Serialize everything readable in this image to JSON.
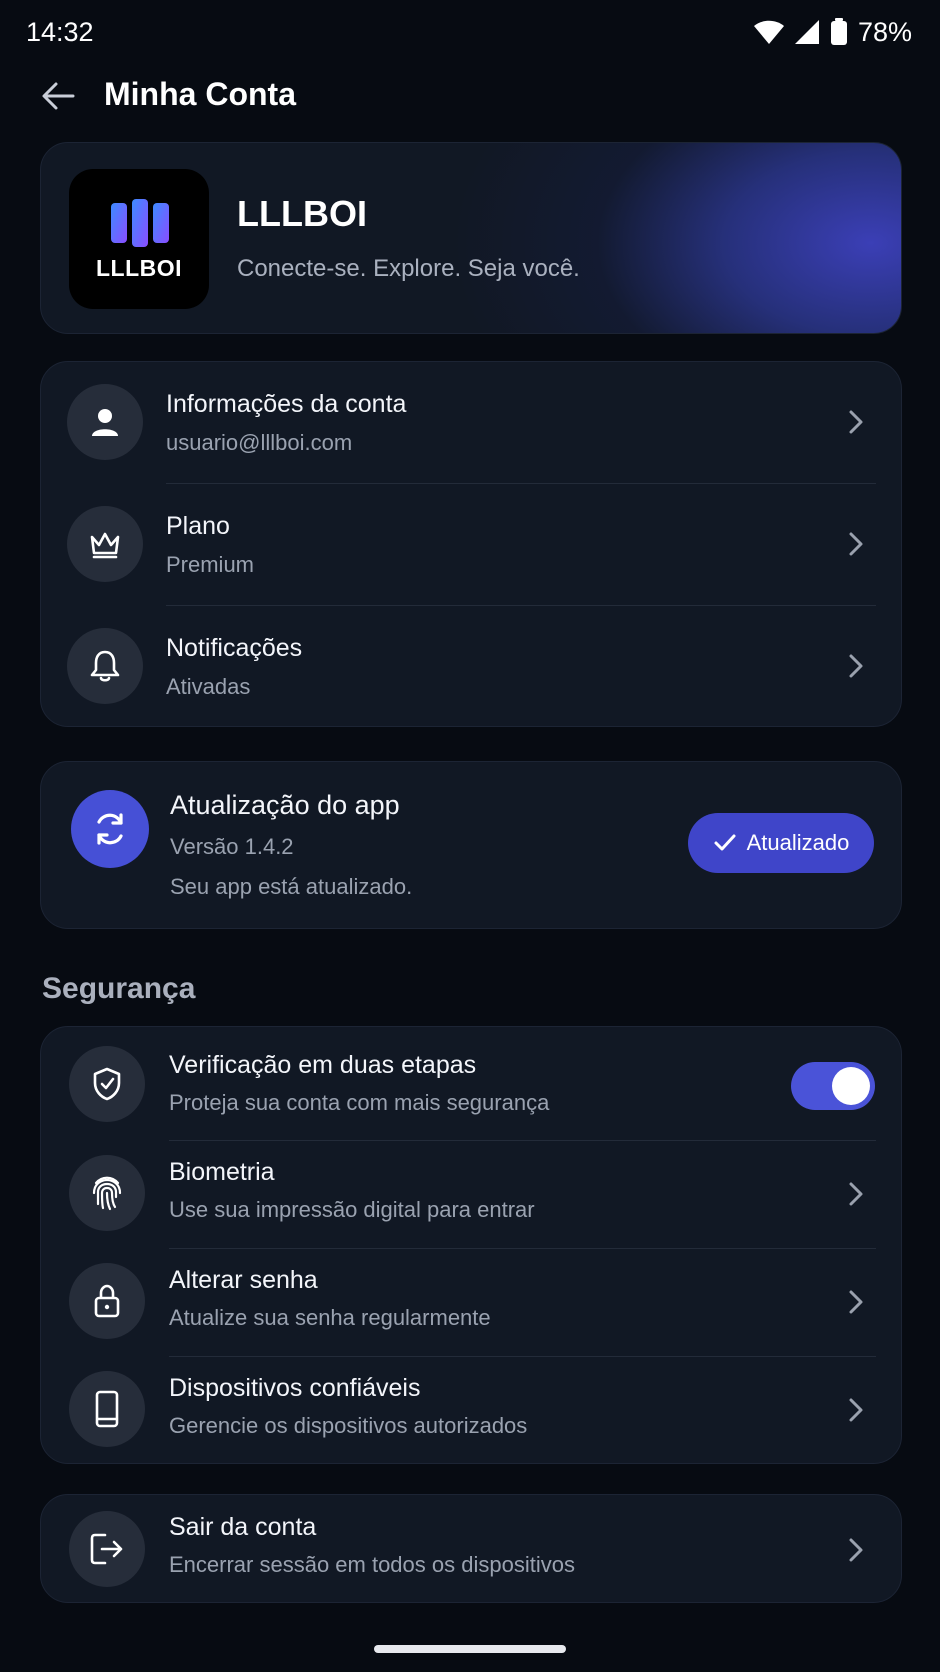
{
  "status_bar": {
    "time": "14:32",
    "battery": "78%"
  },
  "header": {
    "title": "Minha Conta"
  },
  "hero": {
    "logo_text": "LLLBOI",
    "title": "LLLBOI",
    "subtitle": "Conecte-se. Explore. Seja você."
  },
  "account": {
    "items": [
      {
        "title": "Informações da conta",
        "subtitle": "usuario@lllboi.com",
        "icon": "user-icon"
      },
      {
        "title": "Plano",
        "subtitle": "Premium",
        "icon": "crown-icon"
      },
      {
        "title": "Notificações",
        "subtitle": "Ativadas",
        "icon": "bell-icon"
      }
    ]
  },
  "update": {
    "title": "Atualização do app",
    "version": "Versão 1.4.2",
    "status": "Seu app está atualizado.",
    "button_label": "Atualizado",
    "icon": "refresh-icon"
  },
  "security": {
    "section_title": "Segurança",
    "items": [
      {
        "title": "Verificação em duas etapas",
        "subtitle": "Proteja sua conta com mais segurança",
        "icon": "shield-check-icon",
        "toggle_on": true
      },
      {
        "title": "Biometria",
        "subtitle": "Use sua impressão digital para entrar",
        "icon": "fingerprint-icon"
      },
      {
        "title": "Alterar senha",
        "subtitle": "Atualize sua senha regularmente",
        "icon": "lock-icon"
      },
      {
        "title": "Dispositivos confiáveis",
        "subtitle": "Gerencie os dispositivos autorizados",
        "icon": "phone-icon"
      }
    ]
  },
  "logout": {
    "title": "Sair da conta",
    "subtitle": "Encerrar sessão em todos os dispositivos",
    "icon": "logout-icon"
  },
  "colors": {
    "background": "#070b12",
    "card": "#111824",
    "accent": "#4650d6",
    "icon_circle": "#262d3a"
  }
}
